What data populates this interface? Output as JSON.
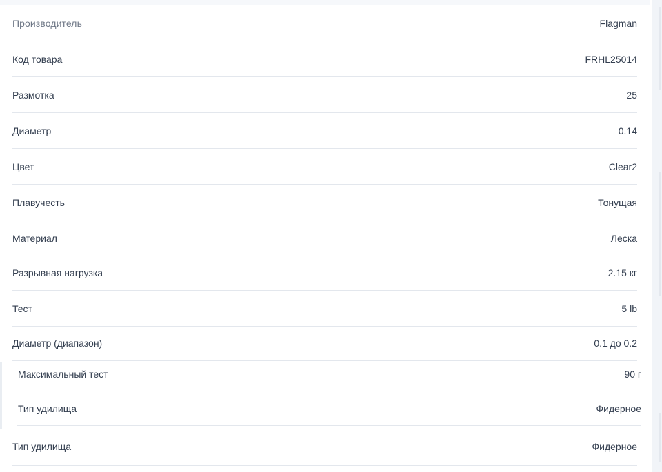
{
  "specs": {
    "rows": [
      {
        "label": "Производитель",
        "value": "Flagman"
      },
      {
        "label": "Код товара",
        "value": "FRHL25014"
      },
      {
        "label": "Размотка",
        "value": "25"
      },
      {
        "label": "Диаметр",
        "value": "0.14"
      },
      {
        "label": "Цвет",
        "value": "Clear2"
      },
      {
        "label": "Плавучесть",
        "value": "Тонущая"
      },
      {
        "label": "Материал",
        "value": "Леска"
      },
      {
        "label": "Разрывная нагрузка",
        "value": "2.15 кг"
      },
      {
        "label": "Тест",
        "value": "5 lb"
      },
      {
        "label": "Диаметр (диапазон)",
        "value": "0.1 до 0.2"
      },
      {
        "label": "Максимальный тест",
        "value": "90 г"
      },
      {
        "label": "Тип удилища",
        "value": "Фидерное"
      },
      {
        "label": "Тип удилища",
        "value": "Фидерное"
      }
    ]
  }
}
